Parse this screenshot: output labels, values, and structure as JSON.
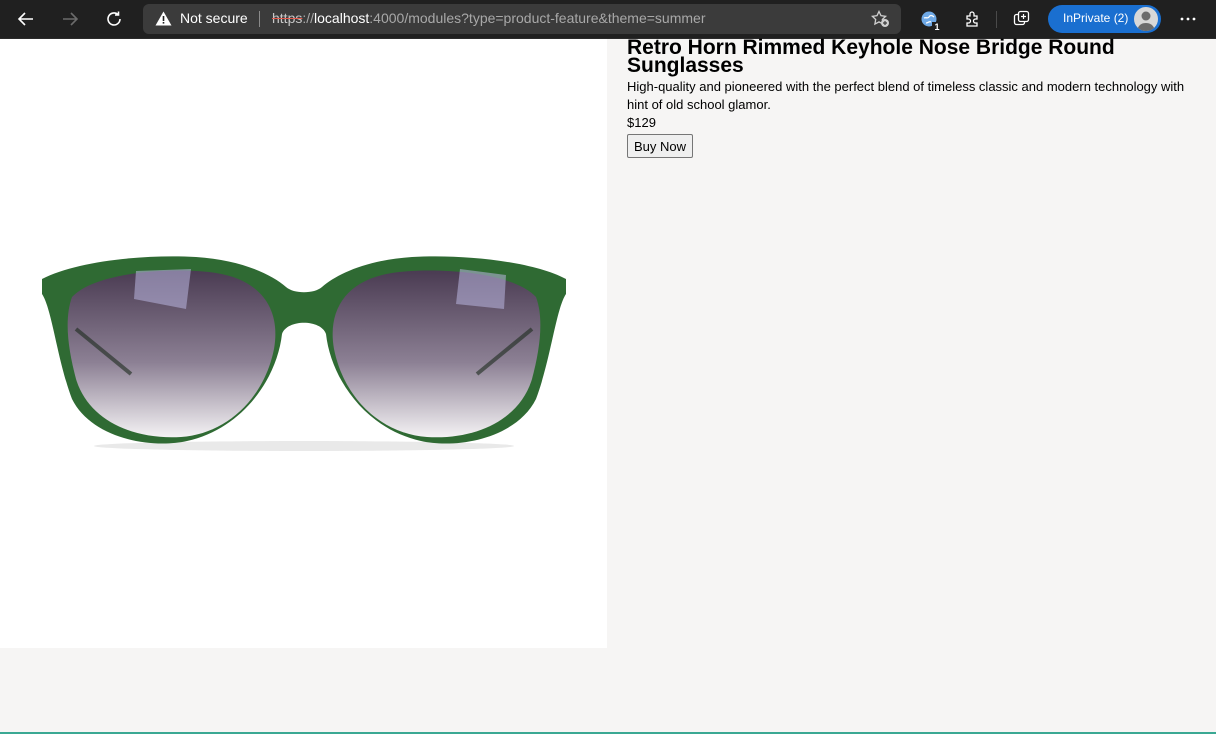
{
  "browser": {
    "security_label": "Not secure",
    "url_protocol": "https",
    "url_separator": "://",
    "url_host": "localhost",
    "url_rest": ":4000/modules?type=product-feature&theme=summer",
    "inprivate_label": "InPrivate (2)",
    "extensions_badge": "1",
    "icons": [
      "back-icon",
      "forward-icon",
      "refresh-icon",
      "warning-icon",
      "favorite-add-icon",
      "browser-essentials-icon",
      "extensions-icon",
      "collections-icon",
      "more-icon"
    ]
  },
  "product": {
    "title": "Retro Horn Rimmed Keyhole Nose Bridge Round Sunglasses",
    "description": "High-quality and pioneered with the perfect blend of timeless classic and modern technology with hint of old school glamor.",
    "price": "$129",
    "buy_label": "Buy Now",
    "frame_color": "#2f6a33",
    "lens_color": "#5a4a5e"
  }
}
